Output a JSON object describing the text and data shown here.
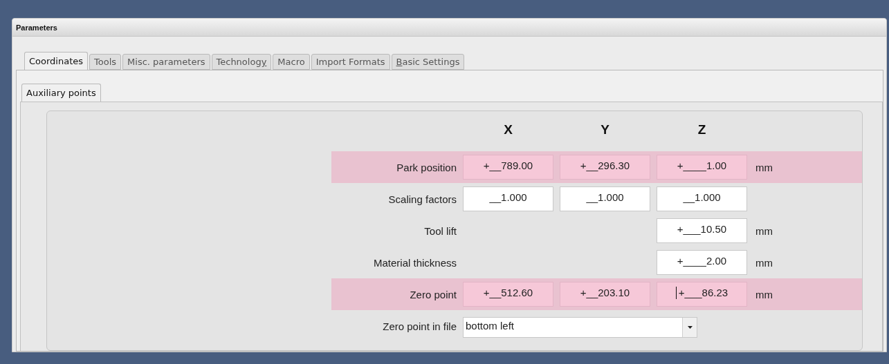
{
  "window": {
    "title": "Parameters"
  },
  "tabs": [
    {
      "label": "Coordinates",
      "selected": true
    },
    {
      "label": "Tools",
      "selected": false
    },
    {
      "label": "Misc. parameters",
      "selected": false
    },
    {
      "label_parts": [
        {
          "text": "Technolog",
          "underlined": false
        },
        {
          "text": "y",
          "underlined": true
        }
      ],
      "selected": false
    },
    {
      "label": "Macro",
      "selected": false
    },
    {
      "label": "Import Formats",
      "selected": false
    },
    {
      "label_parts": [
        {
          "text": "B",
          "underlined": true
        },
        {
          "text": "asic Settings",
          "underlined": false
        }
      ],
      "selected": false
    }
  ],
  "subtabs": [
    {
      "label": "Auxiliary points",
      "selected": true
    }
  ],
  "columns": [
    "X",
    "Y",
    "Z"
  ],
  "rows": [
    {
      "kind": "xyz",
      "label": "Park position",
      "highlighted": true,
      "x": {
        "value": "+__789.00"
      },
      "y": {
        "value": "+__296.30"
      },
      "z": {
        "value": "+____1.00"
      },
      "unit": "mm"
    },
    {
      "kind": "xyz",
      "label": "Scaling factors",
      "highlighted": false,
      "x": {
        "value": "__1.000"
      },
      "y": {
        "value": "__1.000"
      },
      "z": {
        "value": "__1.000"
      }
    },
    {
      "kind": "xyz",
      "label": "Tool lift",
      "highlighted": false,
      "z": {
        "value": "+___10.50"
      },
      "unit": "mm"
    },
    {
      "kind": "xyz",
      "label": "Material thickness",
      "highlighted": false,
      "z": {
        "value": "+____2.00"
      },
      "unit": "mm"
    },
    {
      "kind": "xyz",
      "label": "Zero point",
      "highlighted": true,
      "x": {
        "value": "+__512.60"
      },
      "y": {
        "value": "+__203.10"
      },
      "z": {
        "value": "+___86.23",
        "focused": true
      },
      "unit": "mm"
    },
    {
      "kind": "dropdown",
      "label": "Zero point in file",
      "value": "bottom left"
    }
  ]
}
